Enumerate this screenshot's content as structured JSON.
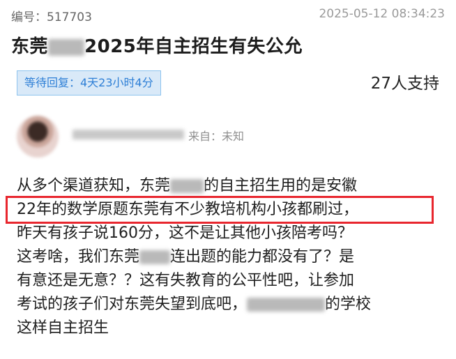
{
  "meta": {
    "id_label": "编号：",
    "id_value": "517703",
    "datetime": "2025-05-12 08:34:23"
  },
  "title": {
    "part1": "东莞",
    "part2": "2025年自主招生有失公允"
  },
  "status": {
    "label": "等待回复：4天23小时4分"
  },
  "support": {
    "label": "27人支持"
  },
  "author": {
    "from_label": "来自：未知"
  },
  "body": {
    "line1_a": "从多个渠道获知，东莞",
    "line1_b": "的自主招生用的是安徽",
    "line2": "22年的数学原题东莞有不少教培机构小孩都刷过，",
    "line3": "昨天有孩子说160分，这不是让其他小孩陪考吗？",
    "line4_a": "这考啥，我们东莞",
    "line4_b": "连出题的能力都没有了？是",
    "line5": "有意还是无意？？这有失教育的公平性吧，让参加",
    "line6_a": "考试的孩子们对东莞失望到底吧，",
    "line6_b": "的学校",
    "line7": "这样自主招生"
  }
}
